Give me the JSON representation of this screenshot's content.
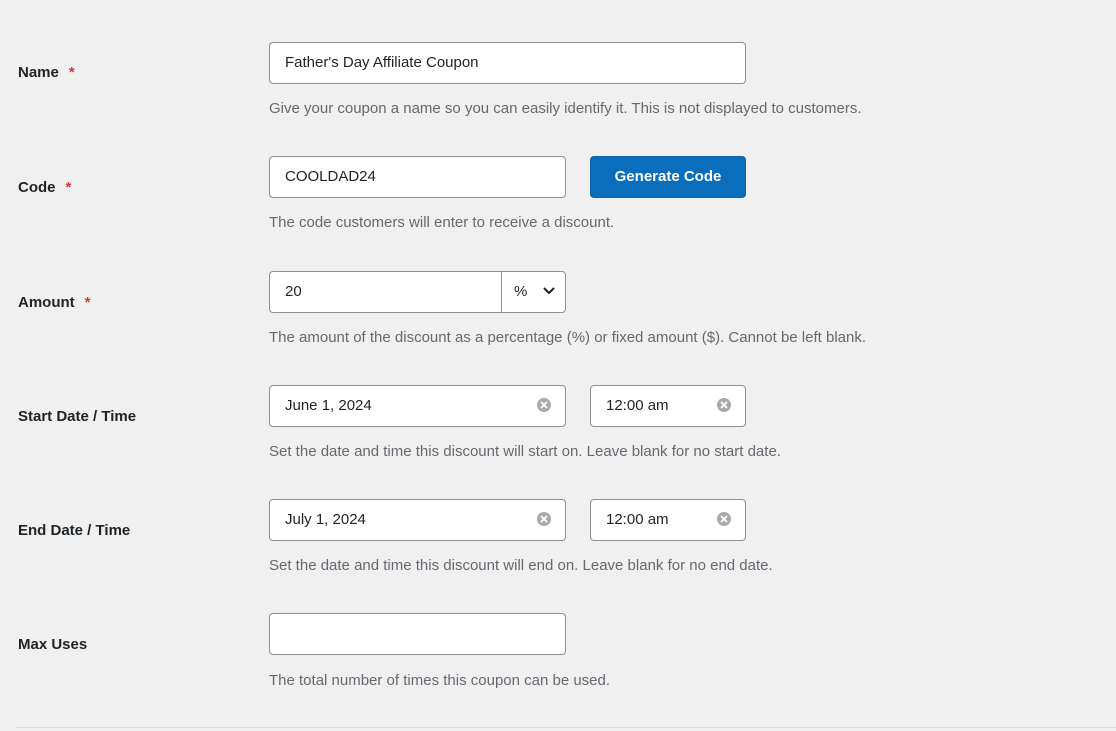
{
  "fields": {
    "name": {
      "label": "Name",
      "required_mark": "*",
      "value": "Father's Day Affiliate Coupon",
      "description": "Give your coupon a name so you can easily identify it. This is not displayed to customers."
    },
    "code": {
      "label": "Code",
      "required_mark": "*",
      "value": "COOLDAD24",
      "generate_button": "Generate Code",
      "description": "The code customers will enter to receive a discount."
    },
    "amount": {
      "label": "Amount",
      "required_mark": "*",
      "value": "20",
      "type_selected": "%",
      "description": "The amount of the discount as a percentage (%) or fixed amount ($). Cannot be left blank."
    },
    "start": {
      "label": "Start Date / Time",
      "date": "June 1, 2024",
      "time": "12:00 am",
      "description": "Set the date and time this discount will start on. Leave blank for no start date."
    },
    "end": {
      "label": "End Date / Time",
      "date": "July 1, 2024",
      "time": "12:00 am",
      "description": "Set the date and time this discount will end on. Leave blank for no end date."
    },
    "max_uses": {
      "label": "Max Uses",
      "value": "",
      "description": "The total number of times this coupon can be used."
    }
  },
  "colors": {
    "primary": "#0a6ebd",
    "required": "#d63638",
    "background": "#f0f0f1"
  }
}
